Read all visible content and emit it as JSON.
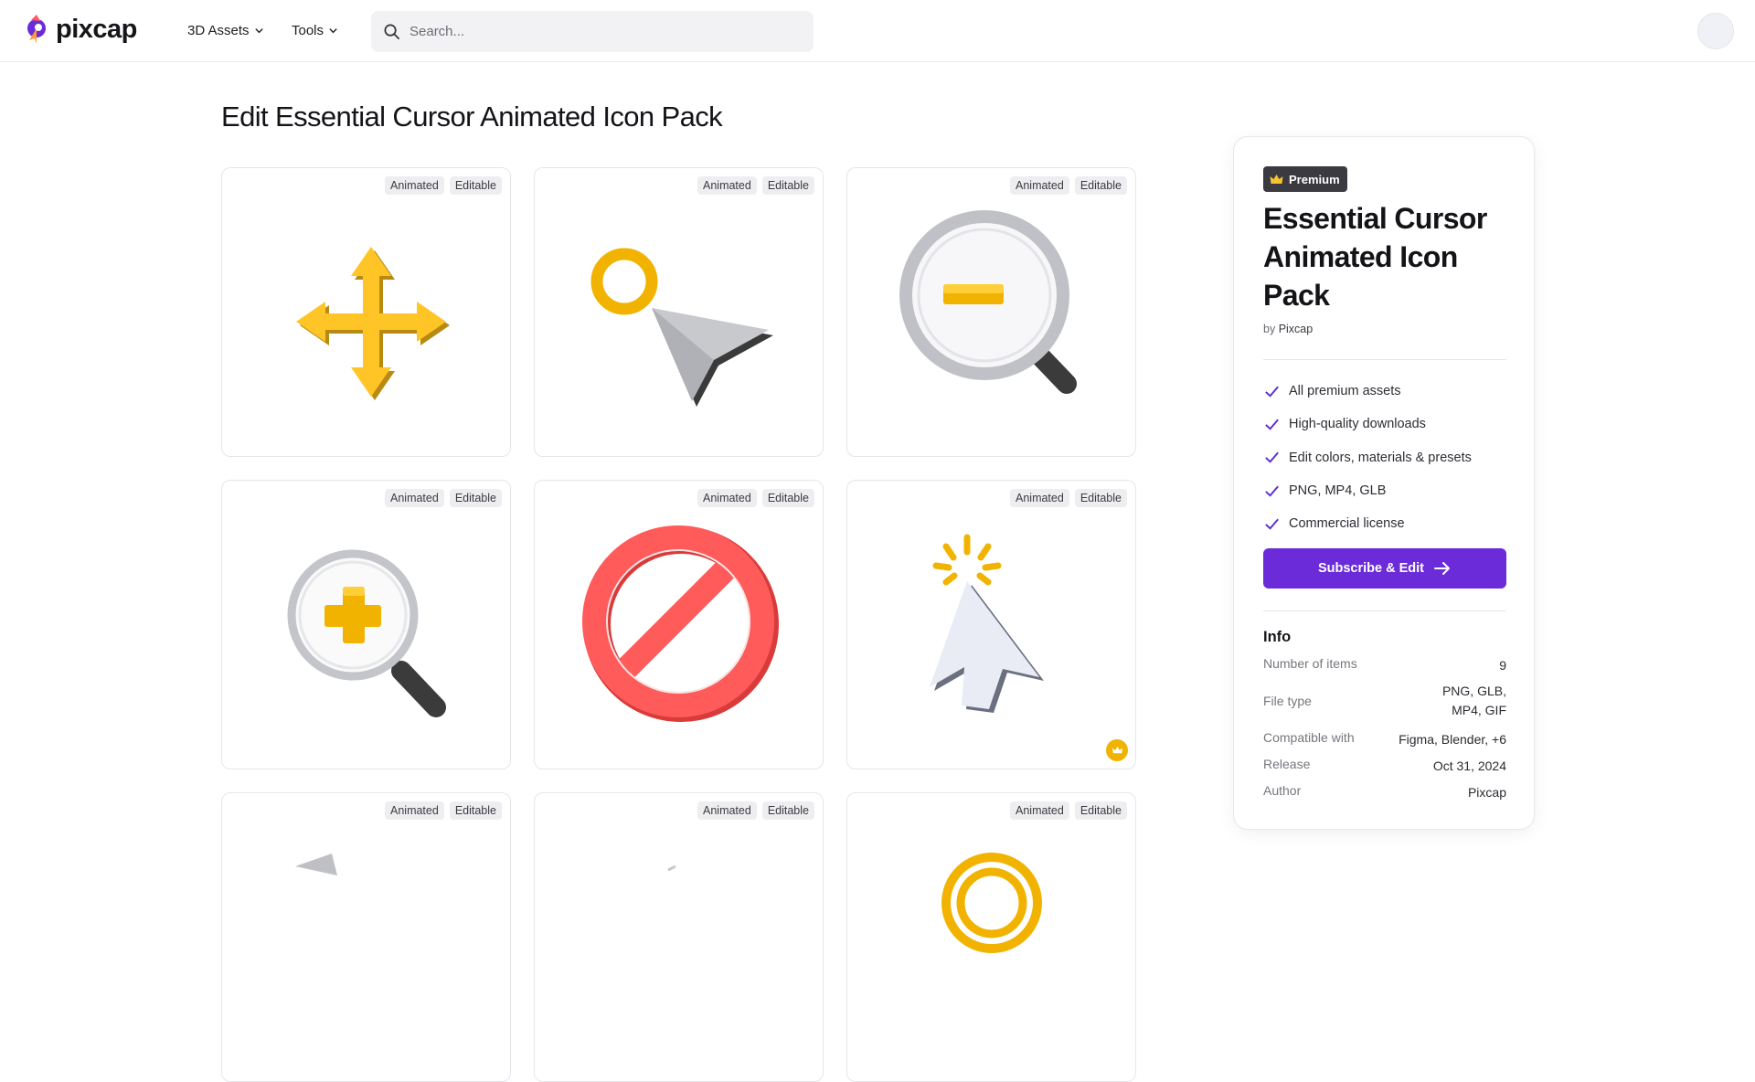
{
  "header": {
    "brand": "pixcap",
    "nav": [
      {
        "label": "3D Assets"
      },
      {
        "label": "Tools"
      }
    ],
    "search_placeholder": "Search..."
  },
  "page": {
    "title": "Edit Essential Cursor Animated Icon Pack"
  },
  "grid": {
    "items": [
      {
        "tags": [
          "Animated",
          "Editable"
        ],
        "icon": "move-arrows-icon",
        "premium": false
      },
      {
        "tags": [
          "Animated",
          "Editable"
        ],
        "icon": "cursor-pointer-icon",
        "premium": false
      },
      {
        "tags": [
          "Animated",
          "Editable"
        ],
        "icon": "zoom-out-icon",
        "premium": false
      },
      {
        "tags": [
          "Animated",
          "Editable"
        ],
        "icon": "zoom-in-icon",
        "premium": false
      },
      {
        "tags": [
          "Animated",
          "Editable"
        ],
        "icon": "prohibited-icon",
        "premium": false
      },
      {
        "tags": [
          "Animated",
          "Editable"
        ],
        "icon": "click-cursor-icon",
        "premium": true
      },
      {
        "tags": [
          "Animated",
          "Editable"
        ],
        "icon": "cursor-icon",
        "premium": false
      },
      {
        "tags": [
          "Animated",
          "Editable"
        ],
        "icon": "cursor-icon",
        "premium": false
      },
      {
        "tags": [
          "Animated",
          "Editable"
        ],
        "icon": "target-icon",
        "premium": false
      }
    ]
  },
  "panel": {
    "badge": "Premium",
    "title": "Essential Cursor Animated Icon Pack",
    "by_prefix": "by",
    "author_link": "Pixcap",
    "features": [
      "All premium assets",
      "High-quality downloads",
      "Edit colors, materials & presets",
      "PNG, MP4, GLB",
      "Commercial license"
    ],
    "cta": "Subscribe & Edit",
    "info_title": "Info",
    "info": [
      {
        "key": "Number of items",
        "value": "9"
      },
      {
        "key": "File type",
        "value": "PNG, GLB,",
        "value2": "MP4, GIF"
      },
      {
        "key": "Compatible with",
        "value": "Figma, Blender, +6"
      },
      {
        "key": "Release",
        "value": "Oct 31, 2024"
      },
      {
        "key": "Author",
        "value": "Pixcap"
      }
    ]
  },
  "colors": {
    "accent": "#6b2bd9",
    "check": "#5b2bd0",
    "premium_gold": "#f0b400",
    "badge_bg": "#3a3a40"
  }
}
